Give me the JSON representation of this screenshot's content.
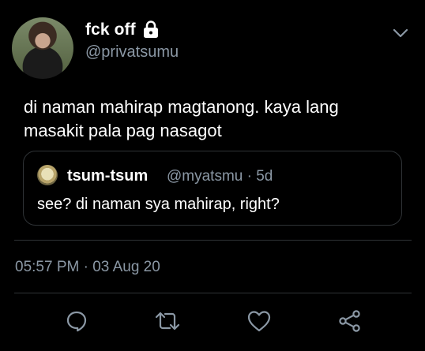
{
  "tweet": {
    "display_name": "fck off",
    "handle": "@privatsumu",
    "text": "di naman mahirap magtanong. kaya lang masakit pala pag nasagot",
    "timestamp": "05:57 PM · 03 Aug 20"
  },
  "quote": {
    "display_name": "tsum-tsum",
    "handle_time": "@myatsmu · 5d",
    "text": "see? di naman sya mahirap, right?"
  },
  "icons": {
    "lock": "lock-icon",
    "more": "chevron-down-icon",
    "reply": "reply-icon",
    "retweet": "retweet-icon",
    "like": "heart-icon",
    "share": "share-icon"
  },
  "colors": {
    "background": "#000000",
    "text": "#ffffff",
    "secondary": "#8b98a5",
    "border": "#2f3336"
  }
}
